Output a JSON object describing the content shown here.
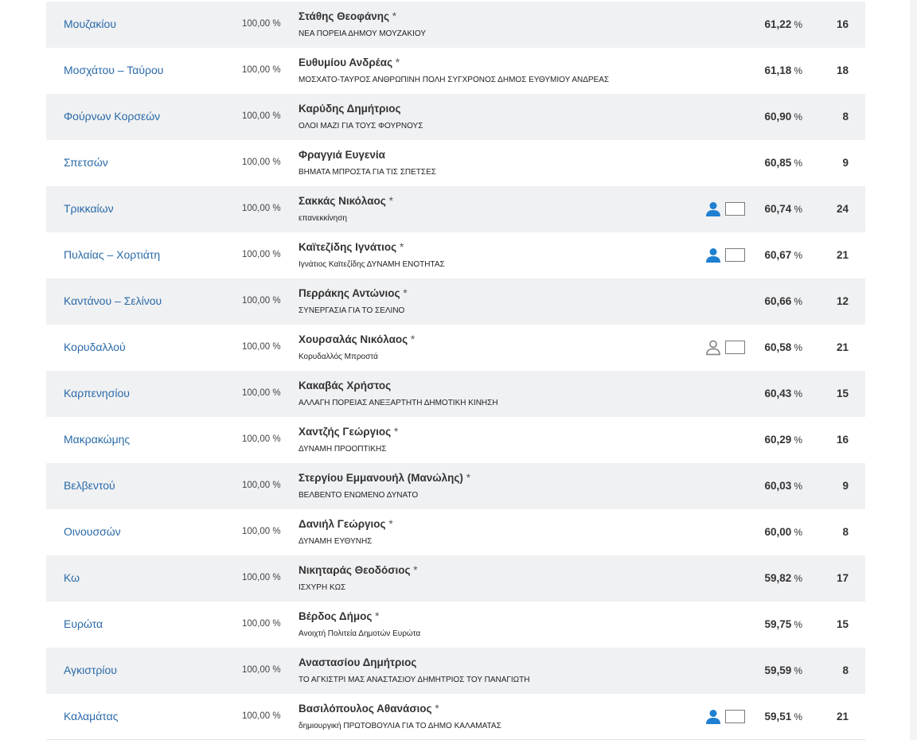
{
  "results": [
    {
      "municipality": "Μουζακίου",
      "counted": "100,00 %",
      "candidate": "Στάθης Θεοφάνης",
      "marker": "*",
      "party": "ΝΕΑ ΠΟΡΕΙΑ ΔΗΜΟΥ ΜΟΥΖΑΚΙΟΥ",
      "icon": "none",
      "percent": "61,22",
      "percent_sign": "%",
      "seats": "16"
    },
    {
      "municipality": "Μοσχάτου – Ταύρου",
      "counted": "100,00 %",
      "candidate": "Ευθυμίου Ανδρέας",
      "marker": "*",
      "party": "ΜΟΣΧΑΤΟ-ΤΑΥΡΟΣ ΑΝΘΡΩΠΙΝΗ ΠΟΛΗ ΣΥΓΧΡΟΝΟΣ ΔΗΜΟΣ ΕΥΘΥΜΙΟΥ ΑΝΔΡΕΑΣ",
      "icon": "none",
      "percent": "61,18",
      "percent_sign": "%",
      "seats": "18"
    },
    {
      "municipality": "Φούρνων Κορσεών",
      "counted": "100,00 %",
      "candidate": "Καρύδης Δημήτριος",
      "marker": "",
      "party": "ΟΛΟΙ ΜΑΖΙ ΓΙΑ ΤΟΥΣ ΦΟΥΡΝΟΥΣ",
      "icon": "none",
      "percent": "60,90",
      "percent_sign": "%",
      "seats": "8"
    },
    {
      "municipality": "Σπετσών",
      "counted": "100,00 %",
      "candidate": "Φραγγιά Ευγενία",
      "marker": "",
      "party": "ΒΗΜΑΤΑ ΜΠΡΟΣΤΑ ΓΙΑ ΤΙΣ ΣΠΕΤΣΕΣ",
      "icon": "none",
      "percent": "60,85",
      "percent_sign": "%",
      "seats": "9"
    },
    {
      "municipality": "Τρικκαίων",
      "counted": "100,00 %",
      "candidate": "Σακκάς Νικόλαος",
      "marker": "*",
      "party": "επανεκκίνηση",
      "icon": "person-filled",
      "percent": "60,74",
      "percent_sign": "%",
      "seats": "24"
    },
    {
      "municipality": "Πυλαίας – Χορτιάτη",
      "counted": "100,00 %",
      "candidate": "Καϊτεζίδης Ιγνάτιος",
      "marker": "*",
      "party": "Ιγνάτιος Καϊτεζίδης ΔΥΝΑΜΗ ΕΝΟΤΗΤΑΣ",
      "icon": "person-filled",
      "percent": "60,67",
      "percent_sign": "%",
      "seats": "21"
    },
    {
      "municipality": "Καντάνου – Σελίνου",
      "counted": "100,00 %",
      "candidate": "Περράκης Αντώνιος",
      "marker": "*",
      "party": "ΣΥΝΕΡΓΑΣΙΑ ΓΙΑ ΤΟ ΣΕΛΙΝΟ",
      "icon": "none",
      "percent": "60,66",
      "percent_sign": "%",
      "seats": "12"
    },
    {
      "municipality": "Κορυδαλλού",
      "counted": "100,00 %",
      "candidate": "Χουρσαλάς Νικόλαος",
      "marker": "*",
      "party": "Κορυδαλλός Μπροστά",
      "icon": "person-outline",
      "percent": "60,58",
      "percent_sign": "%",
      "seats": "21"
    },
    {
      "municipality": "Καρπενησίου",
      "counted": "100,00 %",
      "candidate": "Κακαβάς Χρήστος",
      "marker": "",
      "party": "ΑΛΛΑΓΗ ΠΟΡΕΙΑΣ ΑΝΕΞΑΡΤΗΤΗ ΔΗΜΟΤΙΚΗ ΚΙΝΗΣΗ",
      "icon": "none",
      "percent": "60,43",
      "percent_sign": "%",
      "seats": "15"
    },
    {
      "municipality": "Μακρακώμης",
      "counted": "100,00 %",
      "candidate": "Χαντζής Γεώργιος",
      "marker": "*",
      "party": "ΔΥΝΑΜΗ ΠΡΟΟΠΤΙΚΗΣ",
      "icon": "none",
      "percent": "60,29",
      "percent_sign": "%",
      "seats": "16"
    },
    {
      "municipality": "Βελβεντού",
      "counted": "100,00 %",
      "candidate": "Στεργίου Εμμανουήλ (Μανώλης)",
      "marker": "*",
      "party": "ΒΕΛΒΕΝΤΟ ΕΝΩΜΕΝΟ ΔΥΝΑΤΟ",
      "icon": "none",
      "percent": "60,03",
      "percent_sign": "%",
      "seats": "9"
    },
    {
      "municipality": "Οινουσσών",
      "counted": "100,00 %",
      "candidate": "Δανιήλ Γεώργιος",
      "marker": "*",
      "party": "ΔΥΝΑΜΗ ΕΥΘΥΝΗΣ",
      "icon": "none",
      "percent": "60,00",
      "percent_sign": "%",
      "seats": "8"
    },
    {
      "municipality": "Κω",
      "counted": "100,00 %",
      "candidate": "Νικηταράς Θεοδόσιος",
      "marker": "*",
      "party": "ΙΣΧΥΡΗ ΚΩΣ",
      "icon": "none",
      "percent": "59,82",
      "percent_sign": "%",
      "seats": "17"
    },
    {
      "municipality": "Ευρώτα",
      "counted": "100,00 %",
      "candidate": "Βέρδος Δήμος",
      "marker": "*",
      "party": "Ανοιχτή Πολιτεία Δημοτών Ευρώτα",
      "icon": "none",
      "percent": "59,75",
      "percent_sign": "%",
      "seats": "15"
    },
    {
      "municipality": "Αγκιστρίου",
      "counted": "100,00 %",
      "candidate": "Αναστασίου Δημήτριος",
      "marker": "",
      "party": "ΤΟ ΑΓΚΙΣΤΡΙ ΜΑΣ ΑΝΑΣΤΑΣΙΟΥ ΔΗΜΗΤΡΙΟΣ ΤΟΥ ΠΑΝΑΓΙΩΤΗ",
      "icon": "none",
      "percent": "59,59",
      "percent_sign": "%",
      "seats": "8"
    },
    {
      "municipality": "Καλαμάτας",
      "counted": "100,00 %",
      "candidate": "Βασιλόπουλος Αθανάσιος",
      "marker": "*",
      "party": "δημιουργική ΠΡΩΤΟΒΟΥΛΙΑ ΓΙΑ ΤΟ ΔΗΜΟ ΚΑΛΑΜΑΤΑΣ",
      "icon": "person-filled",
      "percent": "59,51",
      "percent_sign": "%",
      "seats": "21"
    }
  ],
  "colors": {
    "link": "#2a6aa8",
    "icon_filled": "#1f7fd1",
    "icon_outline": "#8a8a8a",
    "row_shaded": "#f0f1f3"
  }
}
